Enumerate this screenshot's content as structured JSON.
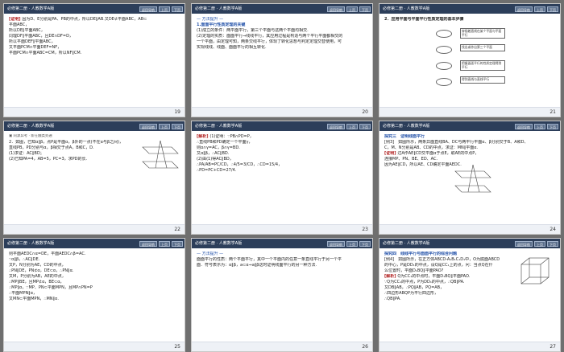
{
  "header_title": "必修第二册 · 人教数学A版",
  "nav": {
    "back": "返回导航",
    "prev": "上页",
    "next": "下页"
  },
  "slides": [
    {
      "page": "19",
      "lines": [
        {
          "tag": "[证明]",
          "text": "因为D、E分别是PA、PB的中点，所以DE∥AB.又DE⊄平面ABC，AB⊂"
        },
        {
          "text": "平面ABC，"
        },
        {
          "text": "所以DE∥平面ABC，"
        },
        {
          "text": "同理DF∥平面ABC，且DE∩DF=D，"
        },
        {
          "text": "所以平面DEF∥平面ABC，"
        },
        {
          "text": "又平面PCM∩平面DEF=NF，"
        },
        {
          "text": "平面PCM∩平面ABC=CM，所以NF∥CM."
        }
      ]
    },
    {
      "page": "20",
      "lines": [
        {
          "sec": "— 方法提升 —"
        },
        {
          "blue": "1.面面平行性质定理的关键"
        },
        {
          "text": "(1)成立的条件：两平面平行，第三个平面与这两个平面均相交."
        },
        {
          "text": "(2)定理的实质：面面平行⇒线线平行，其应用过程是构造与两个平行平面都相交的"
        },
        {
          "text": "一个平面，由定理可知，两条交线平行，体现了转化思想与判定定理交替使用，可"
        },
        {
          "text": "实现线线、线面、面面平行的相互转化."
        }
      ]
    },
    {
      "page": "21",
      "heading": "2．应用平面与平面平行性质定理的基本步骤",
      "flow_left": [
        "",
        "",
        "",
        ""
      ],
      "flow_right": [
        "穿插着直线在某个平面与平面平行",
        "找出或作出第三个平面",
        "把握面面平行的性质定理得到平行",
        "得到直线与直线平行"
      ]
    },
    {
      "page": "22",
      "badge": "同源异考 · 新在触类旁通",
      "lines": [
        {
          "text": "2．如图，已知α∥β，点P是平面α，β外的一点(不在α与β之间)，"
        },
        {
          "text": "直线PB，PD分别与α，β相交于点A，B和C，D."
        },
        {
          "text": "(1)求证：AC∥BD；"
        },
        {
          "text": "(2)已知PA=4，AB=5，PC=3，求PD的长."
        }
      ]
    },
    {
      "page": "23",
      "lines": [
        {
          "tag": "[解析]",
          "text": "(1)证明：∵PB∩PD=P，"
        },
        {
          "text": "∴直线PB和PD确定一个平面γ，"
        },
        {
          "text": "则α∩γ=AC，β∩γ=BD."
        },
        {
          "text": "又α∥β，∴AC∥BD."
        },
        {
          "text": "(2)由(1)得AC∥BD，"
        },
        {
          "text": "∴PA/AB=PC/CD，∴4/5=3/CD，∴CD=15/4，"
        },
        {
          "text": "∴PD=PC+CD=27/4."
        }
      ]
    },
    {
      "page": "24",
      "lines": [
        {
          "blue": "探究三　证明线面平行"
        },
        {
          "text": "[例3]　如图所示，两条异面直线BA、DC与两平行平面α、β分别交于B、A和D、"
        },
        {
          "text": "C，M、N分别是AB、CD的中点，求证：MN∥平面α."
        },
        {
          "tag": "[证明]",
          "text": "过A作AE∥CD交平面α于点E，取AE的中点P，"
        },
        {
          "text": "连接MP、PN、BE、ED、AC."
        },
        {
          "text": "因为AE∥CD，所以AE、CD确定平面AEDC."
        }
      ]
    },
    {
      "page": "25",
      "lines": [
        {
          "text": "则平面AEDC∩α=DE，平面AEDC∩β=AC."
        },
        {
          "text": "∵α∥β，∴AC∥DE."
        },
        {
          "text": "又P，N分别为AE，CD的中点，"
        },
        {
          "text": "∴PN∥DE，PN⊄α，DE⊂α，∴PN∥α."
        },
        {
          "text": "又M，P分别为AB，AE的中点，"
        },
        {
          "text": "∴MP∥BE，且MP⊄α，BE⊂α，"
        },
        {
          "text": "∴MP∥α，∵MP、PN⊂平面MPN，且MP∩PN=P"
        },
        {
          "text": "∴平面MPN∥α，"
        },
        {
          "text": "又MN⊂平面MPN，∴MN∥α."
        }
      ]
    },
    {
      "page": "26",
      "lines": [
        {
          "sec": "— 方法提升 —"
        },
        {
          "text": "面面平行的性质：两个平面平行，其中一个平面内的任意一条直线平行于另一个平"
        },
        {
          "text": "面．符号表示为：α∥β，a⊂α⇒a∥β这时证明线面平行的另一种方法."
        }
      ]
    },
    {
      "page": "27",
      "lines": [
        {
          "blue": "探究四　线线平行与面面平行的综合问题"
        },
        {
          "text": "[例4]　如图所示，在正方体ABCD-A₁B₁C₁D₁中，O为底面ABCD"
        },
        {
          "text": "的中心，P是DD₁的中点，设Q是CC₁上的点，问：当点Q在什"
        },
        {
          "text": "么位置时，平面D₁BQ∥平面PAO?"
        },
        {
          "tag": "[解析]",
          "text": "Q为CC₁的中点时，平面D₁BQ∥平面PAO."
        },
        {
          "text": "∵Q为CC₁的中点，P为DD₁的中点，∴QB∥PA."
        },
        {
          "text": "又DB∥AB，∴PQ∥AB，PQ=AB，"
        },
        {
          "text": "∴四边形ABQP为平行四边形，"
        },
        {
          "text": "∴QB∥PA."
        }
      ]
    }
  ]
}
